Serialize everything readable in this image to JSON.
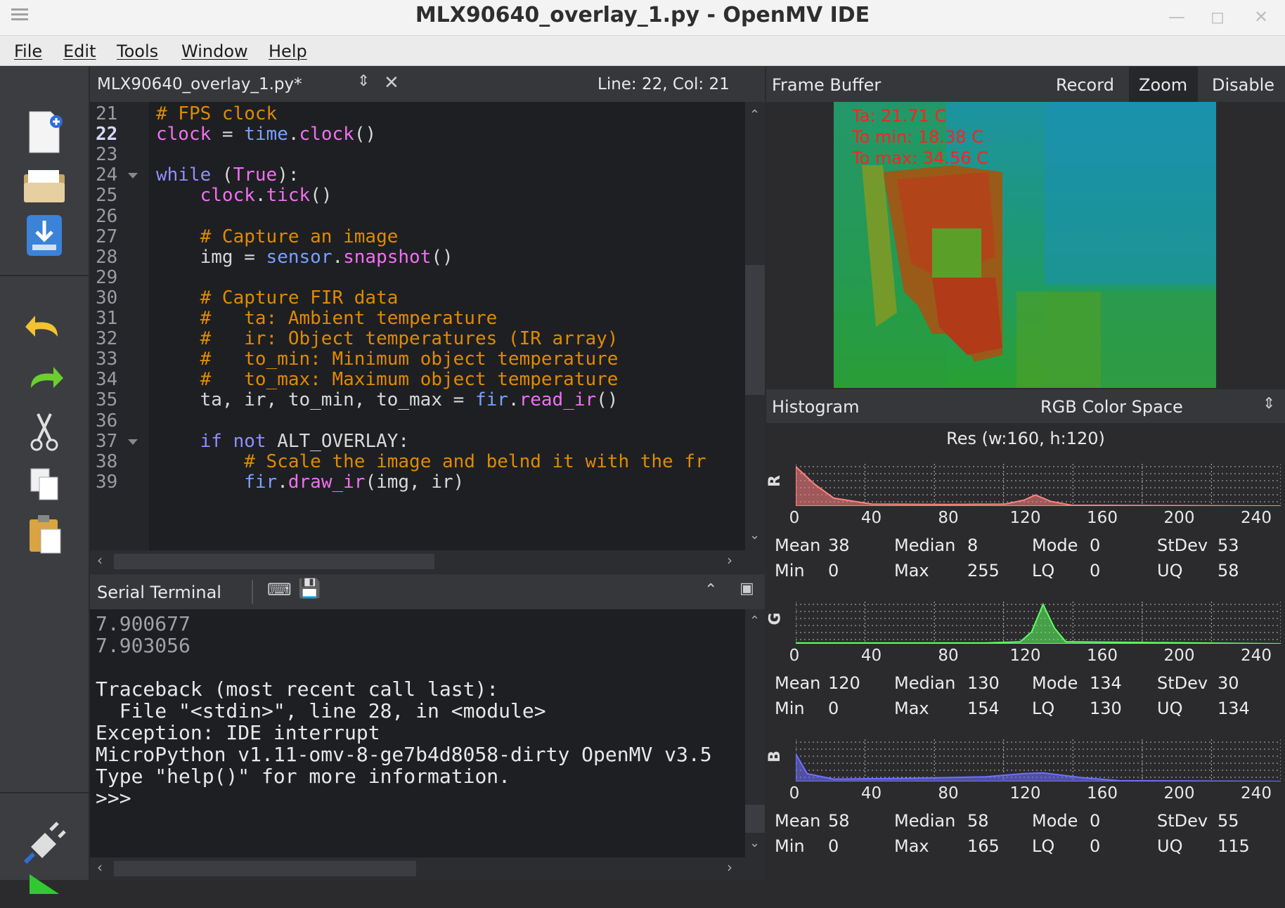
{
  "window": {
    "title": "MLX90640_overlay_1.py - OpenMV IDE"
  },
  "menu": [
    "File",
    "Edit",
    "Tools",
    "Window",
    "Help"
  ],
  "toolbar": {
    "icons": [
      "new-file-icon",
      "open-folder-icon",
      "save-icon",
      "undo-icon",
      "redo-icon",
      "cut-icon",
      "copy-icon",
      "paste-icon",
      "connect-icon",
      "run-icon"
    ]
  },
  "editor": {
    "filename": "MLX90640_overlay_1.py*",
    "position": "Line: 22, Col: 21",
    "lines": [
      {
        "n": "21",
        "text": "# FPS clock"
      },
      {
        "n": "22",
        "text": "clock = time.clock()"
      },
      {
        "n": "23",
        "text": ""
      },
      {
        "n": "24",
        "text": "while (True):"
      },
      {
        "n": "25",
        "text": "    clock.tick()"
      },
      {
        "n": "26",
        "text": ""
      },
      {
        "n": "27",
        "text": "    # Capture an image"
      },
      {
        "n": "28",
        "text": "    img = sensor.snapshot()"
      },
      {
        "n": "29",
        "text": ""
      },
      {
        "n": "30",
        "text": "    # Capture FIR data"
      },
      {
        "n": "31",
        "text": "    #   ta: Ambient temperature"
      },
      {
        "n": "32",
        "text": "    #   ir: Object temperatures (IR array)"
      },
      {
        "n": "33",
        "text": "    #   to_min: Minimum object temperature"
      },
      {
        "n": "34",
        "text": "    #   to_max: Maximum object temperature"
      },
      {
        "n": "35",
        "text": "    ta, ir, to_min, to_max = fir.read_ir()"
      },
      {
        "n": "36",
        "text": ""
      },
      {
        "n": "37",
        "text": "    if not ALT_OVERLAY:"
      },
      {
        "n": "38",
        "text": "        # Scale the image and belnd it with the fr"
      },
      {
        "n": "39",
        "text": "        fir.draw_ir(img, ir)"
      }
    ]
  },
  "serial": {
    "title": "Serial Terminal",
    "lines": [
      "7.900677",
      "7.903056",
      "",
      "Traceback (most recent call last):",
      "  File \"<stdin>\", line 28, in <module>",
      "Exception: IDE interrupt",
      "MicroPython v1.11-omv-8-ge7b4d8058-dirty OpenMV v3.5",
      "Type \"help()\" for more information.",
      ">>>"
    ]
  },
  "framebuffer": {
    "title": "Frame Buffer",
    "buttons": [
      "Record",
      "Zoom",
      "Disable"
    ],
    "overlay": [
      "Ta: 21.71 C",
      "To min: 18.38 C",
      "To max: 34.56 C"
    ]
  },
  "histogram": {
    "title": "Histogram",
    "colorspace": "RGB Color Space",
    "resolution": "Res (w:160, h:120)",
    "axis_ticks": [
      "0",
      "40",
      "80",
      "120",
      "160",
      "200",
      "240"
    ],
    "channels": [
      {
        "label": "R",
        "color": "#ff8080",
        "stats": {
          "Mean": "38",
          "Median": "8",
          "Mode": "0",
          "StDev": "53",
          "Min": "0",
          "Max": "255",
          "LQ": "0",
          "UQ": "58"
        }
      },
      {
        "label": "G",
        "color": "#60ff60",
        "stats": {
          "Mean": "120",
          "Median": "130",
          "Mode": "134",
          "StDev": "30",
          "Min": "0",
          "Max": "154",
          "LQ": "130",
          "UQ": "134"
        }
      },
      {
        "label": "B",
        "color": "#7070ff",
        "stats": {
          "Mean": "58",
          "Median": "58",
          "Mode": "0",
          "StDev": "55",
          "Min": "0",
          "Max": "165",
          "LQ": "0",
          "UQ": "115"
        }
      }
    ]
  }
}
